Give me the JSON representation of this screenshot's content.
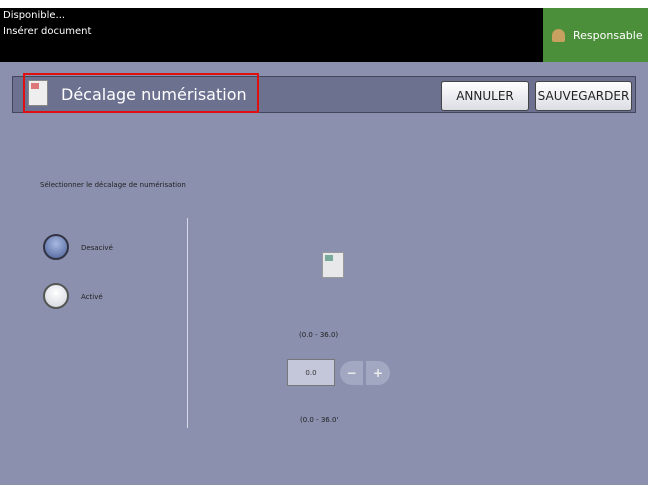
{
  "status": {
    "line1": "Disponible...",
    "line2": "Insérer document"
  },
  "user": {
    "label": "Responsable",
    "icon": "user-icon"
  },
  "header": {
    "title": "Décalage numérisation",
    "cancel": "ANNULER",
    "save": "SAUVEGARDER"
  },
  "content": {
    "prompt": "Sélectionner le décalage de numérisation",
    "options": [
      {
        "label": "Desacivé",
        "selected": true
      },
      {
        "label": "Activé",
        "selected": false
      }
    ],
    "range_top": "(0.0 - 36.0)",
    "value": "0.0",
    "range_bottom": "(0.0 - 36.0'",
    "minus": "−",
    "plus": "+"
  }
}
